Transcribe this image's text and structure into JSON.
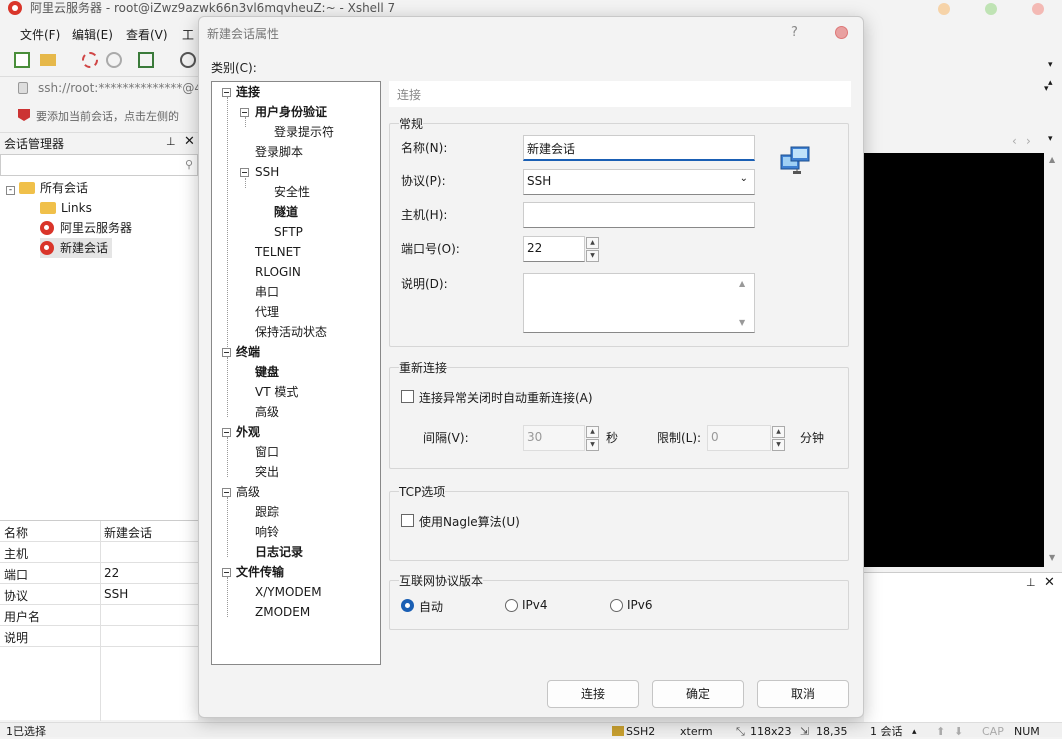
{
  "window": {
    "title": "阿里云服务器 - root@iZwz9azwk66n3vl6mqvheuZ:~ - Xshell 7"
  },
  "menu": [
    "文件(F)",
    "编辑(E)",
    "查看(V)",
    "工"
  ],
  "address": "ssh://root:**************@47.",
  "hint": "要添加当前会话，点击左侧的",
  "session_manager": {
    "title": "会话管理器",
    "tree": {
      "root": "所有会话",
      "items": [
        "Links",
        "阿里云服务器",
        "新建会话"
      ]
    },
    "properties": [
      {
        "key": "名称",
        "value": "新建会话"
      },
      {
        "key": "主机",
        "value": ""
      },
      {
        "key": "端口",
        "value": "22"
      },
      {
        "key": "协议",
        "value": "SSH"
      },
      {
        "key": "用户名",
        "value": ""
      },
      {
        "key": "说明",
        "value": ""
      }
    ]
  },
  "statusbar": {
    "left": "1已选择",
    "proto": "SSH2",
    "term": "xterm",
    "size": "118x23",
    "pos": "18,35",
    "sessions": "1 会话",
    "cap": "CAP",
    "num": "NUM"
  },
  "dialog": {
    "title": "新建会话属性",
    "help": "?",
    "category_label": "类别(C):",
    "tree": [
      {
        "label": "连接",
        "bold": true
      },
      {
        "label": "用户身份验证",
        "bold": true
      },
      {
        "label": "登录提示符",
        "bold": false
      },
      {
        "label": "登录脚本",
        "bold": false
      },
      {
        "label": "SSH",
        "bold": false
      },
      {
        "label": "安全性",
        "bold": false
      },
      {
        "label": "隧道",
        "bold": true
      },
      {
        "label": "SFTP",
        "bold": false
      },
      {
        "label": "TELNET",
        "bold": false
      },
      {
        "label": "RLOGIN",
        "bold": false
      },
      {
        "label": "串口",
        "bold": false
      },
      {
        "label": "代理",
        "bold": false
      },
      {
        "label": "保持活动状态",
        "bold": false
      },
      {
        "label": "终端",
        "bold": true
      },
      {
        "label": "键盘",
        "bold": true
      },
      {
        "label": "VT 模式",
        "bold": false
      },
      {
        "label": "高级",
        "bold": false
      },
      {
        "label": "外观",
        "bold": true
      },
      {
        "label": "窗口",
        "bold": false
      },
      {
        "label": "突出",
        "bold": false
      },
      {
        "label": "高级",
        "bold": false
      },
      {
        "label": "跟踪",
        "bold": false
      },
      {
        "label": "响铃",
        "bold": false
      },
      {
        "label": "日志记录",
        "bold": true
      },
      {
        "label": "文件传输",
        "bold": true
      },
      {
        "label": "X/YMODEM",
        "bold": false
      },
      {
        "label": "ZMODEM",
        "bold": false
      }
    ],
    "section_heading": "连接",
    "general": {
      "title": "常规",
      "name_label": "名称(N):",
      "name_value": "新建会话",
      "protocol_label": "协议(P):",
      "protocol_value": "SSH",
      "host_label": "主机(H):",
      "host_value": "",
      "port_label": "端口号(O):",
      "port_value": "22",
      "desc_label": "说明(D):",
      "desc_value": ""
    },
    "reconnect": {
      "title": "重新连接",
      "checkbox_label": "连接异常关闭时自动重新连接(A)",
      "interval_label": "间隔(V):",
      "interval_value": "30",
      "interval_unit": "秒",
      "limit_label": "限制(L):",
      "limit_value": "0",
      "limit_unit": "分钟"
    },
    "tcp": {
      "title": "TCP选项",
      "nagle_label": "使用Nagle算法(U)"
    },
    "ip_version": {
      "title": "互联网协议版本",
      "options": [
        "自动",
        "IPv4",
        "IPv6"
      ],
      "selected": "自动"
    },
    "buttons": {
      "connect": "连接",
      "ok": "确定",
      "cancel": "取消"
    }
  }
}
